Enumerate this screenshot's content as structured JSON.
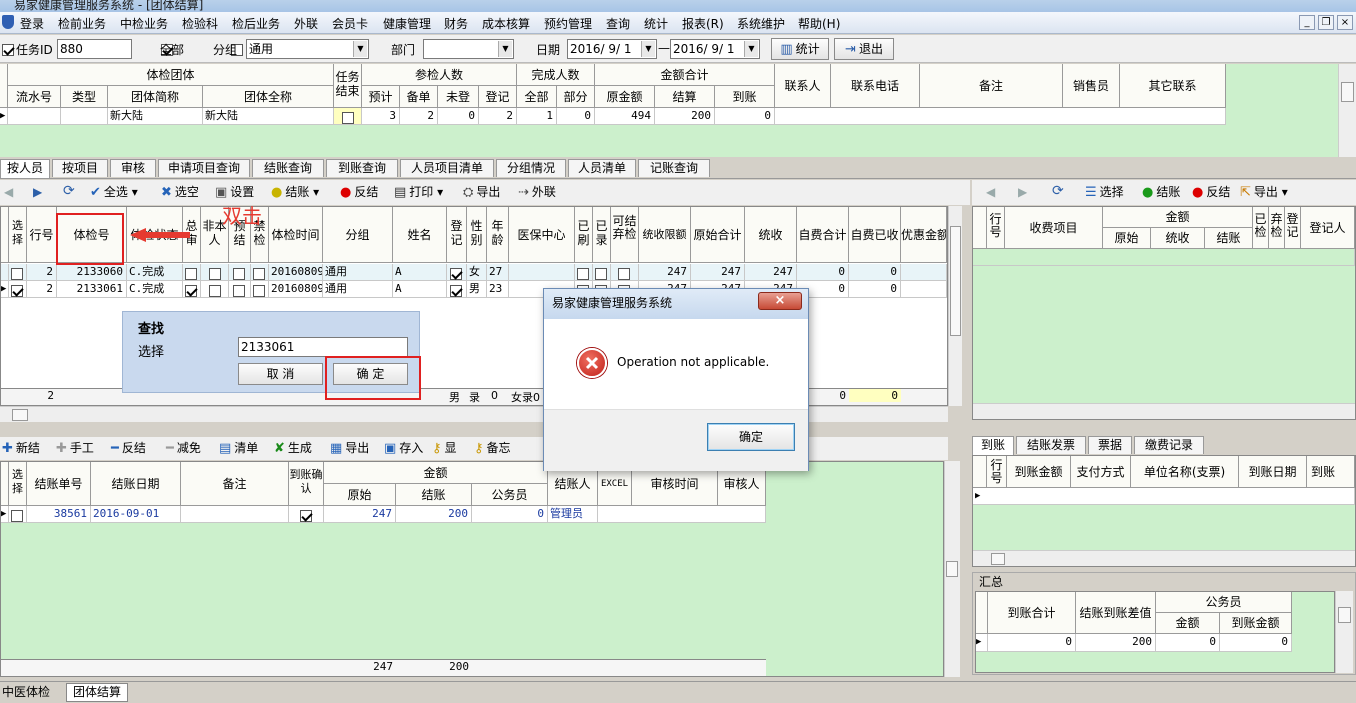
{
  "window": {
    "title": "易家健康管理服务系统 - [团体结算]"
  },
  "menu": [
    "登录",
    "检前业务",
    "中检业务",
    "检验科",
    "检后业务",
    "外联",
    "会员卡",
    "健康管理",
    "财务",
    "成本核算",
    "预约管理",
    "查询",
    "统计",
    "报表(R)",
    "系统维护",
    "帮助(H)"
  ],
  "filters": {
    "task_id_label": "任务ID",
    "task_id_value": "880",
    "all_label": "全部",
    "group_label": "分组",
    "group_value": "通用",
    "dept_label": "部门",
    "date_label": "日期",
    "date_from": "2016/ 9/ 1",
    "date_sep": "—",
    "date_to": "2016/ 9/ 1",
    "stats_btn": "统计",
    "exit_btn": "退出"
  },
  "group_table": {
    "h_group": "体检团体",
    "h_task": "任务结束",
    "h_part": "参检人数",
    "h_done": "完成人数",
    "h_amount": "金额合计",
    "c_serial": "流水号",
    "c_type": "类型",
    "c_short": "团体简称",
    "c_full": "团体全称",
    "c_pre": "预计",
    "c_bak": "备单",
    "c_unreg": "未登",
    "c_reg": "登记",
    "c_all": "全部",
    "c_part": "部分",
    "c_orig": "原金额",
    "c_settle": "结算",
    "c_arrive": "到账",
    "c_contact": "联系人",
    "c_phone": "联系电话",
    "c_note": "备注",
    "c_sales": "销售员",
    "c_other": "其它联系",
    "row": {
      "short": "新大陆",
      "full": "新大陆",
      "pre": "3",
      "bak": "2",
      "unreg": "0",
      "reg": "2",
      "all": "1",
      "part": "0",
      "orig": "494",
      "settle": "200",
      "arrive": "0"
    }
  },
  "tabs": [
    "按人员",
    "按项目",
    "审核",
    "申请项目查询",
    "结账查询",
    "到账查询",
    "人员项目清单",
    "分组情况",
    "人员清单",
    "记账查询"
  ],
  "toolbar2": {
    "select_all": "全选",
    "deselect": "选空",
    "settings": "设置",
    "settle": "结账",
    "unsettle": "反结",
    "print": "打印",
    "export": "导出",
    "outreach": "外联"
  },
  "annotation": "双击",
  "person_table": {
    "headers": [
      "选择",
      "行号",
      "体检号",
      "体检状态",
      "总审",
      "非本人",
      "预结",
      "禁检",
      "体检时间",
      "分组",
      "姓名",
      "登记",
      "性别",
      "年龄",
      "医保中心",
      "已刷",
      "已录",
      "可结弃检",
      "统收限额",
      "原始合计",
      "统收",
      "自费合计",
      "自费已收",
      "优惠金额"
    ],
    "rows": [
      {
        "row": "2",
        "id": "2133060",
        "status": "C.完成",
        "time": "20160809",
        "group": "通用",
        "name": "A",
        "sex": "女",
        "age": "27",
        "limit": "247",
        "orig": "247",
        "coll": "247",
        "self": "0",
        "selfpaid": "0"
      },
      {
        "row": "2",
        "id": "2133061",
        "status": "C.完成",
        "time": "20160809",
        "group": "通用",
        "name": "A",
        "sex": "男",
        "age": "23",
        "limit": "247",
        "orig": "247",
        "coll": "247",
        "self": "0",
        "selfpaid": "0"
      }
    ],
    "footer": {
      "row": "2",
      "sex": "男",
      "reg": "录",
      "age": "0",
      "med": "女录0",
      "a": "0",
      "b": "0"
    }
  },
  "finder": {
    "title": "查找",
    "label": "选择",
    "value": "2133061",
    "cancel": "取 消",
    "ok": "确 定"
  },
  "dialog": {
    "title": "易家健康管理服务系统",
    "message": "Operation not applicable.",
    "ok": "确定"
  },
  "right_toolbar": {
    "select": "选择",
    "settle": "结账",
    "unsettle": "反结",
    "export": "导出"
  },
  "charge_table": {
    "row": "行号",
    "item": "收费项目",
    "amount": "金额",
    "orig": "原始",
    "coll": "统收",
    "settle": "结账",
    "done": "已检",
    "drop": "弃检",
    "reg": "登记",
    "regp": "登记人"
  },
  "bottom_toolbar": {
    "add": "新结",
    "manual": "手工",
    "unsettle": "反结",
    "reduce": "减免",
    "list": "清单",
    "gen": "生成",
    "export": "导出",
    "save": "存入",
    "show": "显",
    "memo": "备忘"
  },
  "settle_table": {
    "select": "选择",
    "no": "结账单号",
    "date": "结账日期",
    "note": "备注",
    "confirm": "到账确认",
    "amount": "金额",
    "orig": "原始",
    "settle": "结账",
    "official": "公务员",
    "person": "结账人",
    "excel": "EXCEL",
    "audit_time": "审核时间",
    "auditor": "审核人",
    "row": {
      "no": "38561",
      "date": "2016-09-01",
      "orig": "247",
      "settle": "200",
      "official": "0",
      "person": "管理员"
    },
    "total": {
      "orig": "247",
      "settle": "200"
    }
  },
  "right_tabs": [
    "到账",
    "结账发票",
    "票据",
    "缴费记录"
  ],
  "arrive_table": {
    "row": "行号",
    "amount": "到账金额",
    "method": "支付方式",
    "unit": "单位名称(支票)",
    "date": "到账日期",
    "more": "到账"
  },
  "summary": {
    "title": "汇总",
    "total": "到账合计",
    "diff": "结账到账差值",
    "official": "公务员",
    "amount": "金额",
    "arrive": "到账金额",
    "v_total": "0",
    "v_diff": "200",
    "v_amount": "0",
    "v_arrive": "0"
  },
  "status_tabs": [
    "中医体检",
    "团体结算"
  ]
}
